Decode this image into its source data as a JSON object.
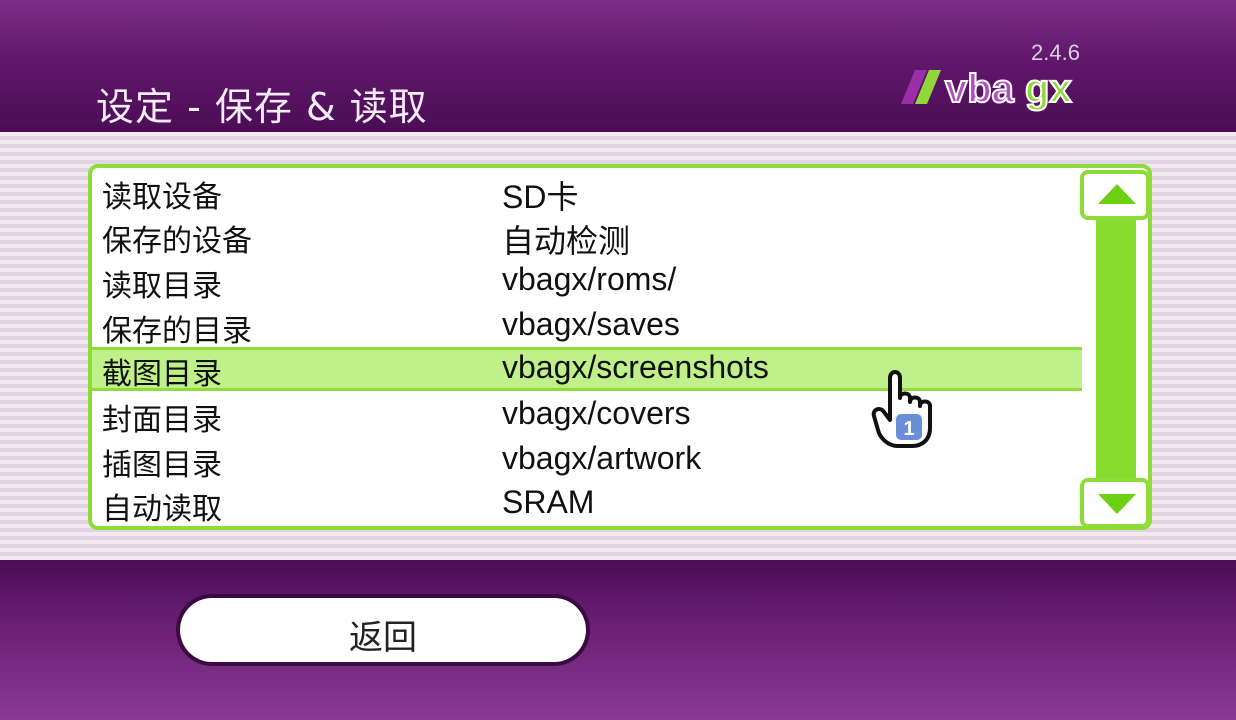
{
  "header": {
    "title": "设定 - 保存 & 读取",
    "logo_text": "vbagx",
    "version": "2.4.6"
  },
  "settings": [
    {
      "label": "读取设备",
      "value": "SD卡"
    },
    {
      "label": "保存的设备",
      "value": "自动检测"
    },
    {
      "label": "读取目录",
      "value": "vbagx/roms/"
    },
    {
      "label": "保存的目录",
      "value": "vbagx/saves"
    },
    {
      "label": "截图目录",
      "value": "vbagx/screenshots",
      "selected": true
    },
    {
      "label": "封面目录",
      "value": "vbagx/covers"
    },
    {
      "label": "插图目录",
      "value": "vbagx/artwork"
    },
    {
      "label": "自动读取",
      "value": "SRAM"
    }
  ],
  "scrollbar": {
    "up_icon": "triangle-up-icon",
    "down_icon": "triangle-down-icon"
  },
  "cursor": {
    "icon": "pointing-hand-cursor-icon",
    "player": "1"
  },
  "footer": {
    "back_label": "返回"
  },
  "colors": {
    "accent_green": "#8ddc3a",
    "header_purple": "#61186b",
    "selected_row": "#bff08a"
  }
}
